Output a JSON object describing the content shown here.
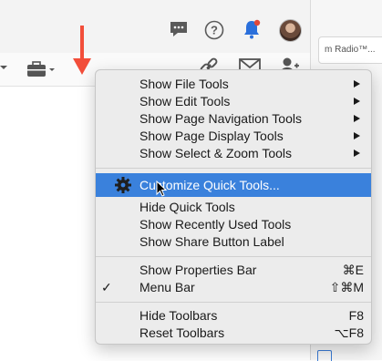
{
  "top_bar": {
    "icons": [
      "comments-icon",
      "help-icon",
      "bell-icon",
      "avatar"
    ]
  },
  "right_panel": {
    "tab_label": "m Radio™..."
  },
  "menu": {
    "groups": [
      [
        {
          "label": "Show File Tools",
          "submenu": true
        },
        {
          "label": "Show Edit Tools",
          "submenu": true
        },
        {
          "label": "Show Page Navigation Tools",
          "submenu": true
        },
        {
          "label": "Show Page Display Tools",
          "submenu": true
        },
        {
          "label": "Show Select & Zoom Tools",
          "submenu": true
        }
      ],
      [
        {
          "label": "Customize Quick Tools...",
          "icon": "gear-icon",
          "highlighted": true
        },
        {
          "label": "Hide Quick Tools"
        },
        {
          "label": "Show Recently Used Tools"
        },
        {
          "label": "Show Share Button Label"
        }
      ],
      [
        {
          "label": "Show Properties Bar",
          "shortcut": "⌘E"
        },
        {
          "label": "Menu Bar",
          "checked": true,
          "shortcut": "⇧⌘M"
        }
      ],
      [
        {
          "label": "Hide Toolbars",
          "shortcut": "F8"
        },
        {
          "label": "Reset Toolbars",
          "shortcut": "⌥F8"
        }
      ]
    ]
  },
  "colors": {
    "highlight": "#3a81dc",
    "annotation_arrow": "#f24e3a",
    "notification_dot": "#e0473a",
    "bell": "#2a6fdb"
  }
}
